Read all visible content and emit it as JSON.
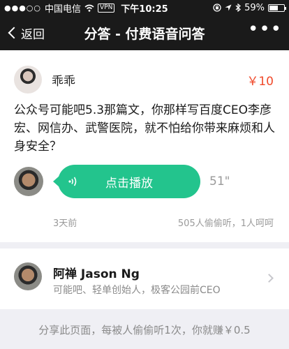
{
  "status_bar": {
    "signal": "●●●○○",
    "carrier": "中国电信",
    "vpn": "VPN",
    "time": "下午10:25",
    "battery": "59%",
    "battery_level": 0.59
  },
  "nav": {
    "back_label": "返回",
    "title": "分答 - 付费语音问答",
    "more": "•••"
  },
  "question_card": {
    "asker_name": "乖乖",
    "price": "￥10",
    "question_text": "公众号可能吧5.3那篇文，你那样写百度CEO李彦宏、网信办、武警医院，就不怕给你带来麻烦和人身安全？",
    "play_label": "点击播放",
    "duration": "51\"",
    "posted": "3天前",
    "stats": "505人偷偷听，1人呵呵"
  },
  "answerer_card": {
    "name": "阿禅 Jason Ng",
    "description": "可能吧、轻单创始人，极客公园前CEO"
  },
  "footer": {
    "share_note": "分享此页面，每被人偷偷听1次，你就赚￥0.5"
  },
  "colors": {
    "accent_green": "#23c48d",
    "price_red": "#f04a2b",
    "bar_dark": "#1a1a1a"
  }
}
